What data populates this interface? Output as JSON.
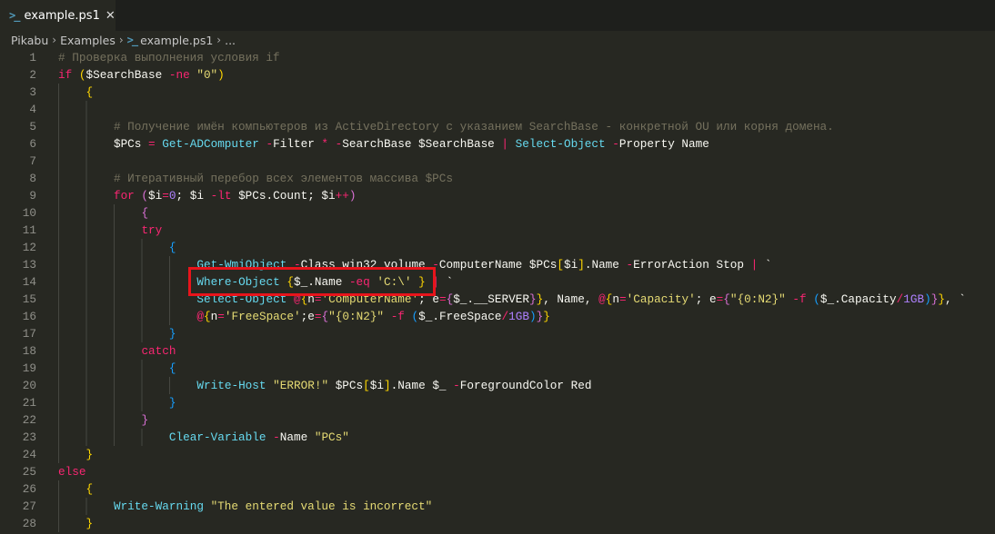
{
  "tab": {
    "title": "example.ps1",
    "icon": "powershell-icon"
  },
  "breadcrumb": [
    "Pikabu",
    "Examples",
    "example.ps1",
    "..."
  ],
  "lines": [
    {
      "i": 0,
      "t": [
        [
          "c",
          "# Проверка выполнения условия if"
        ]
      ]
    },
    {
      "i": 0,
      "t": [
        [
          "k",
          "if"
        ],
        [
          "t",
          " "
        ],
        [
          "b1",
          "("
        ],
        [
          "t",
          "$SearchBase "
        ],
        [
          "o",
          "-ne"
        ],
        [
          "t",
          " "
        ],
        [
          "s",
          "\"0\""
        ],
        [
          "b1",
          ")"
        ]
      ]
    },
    {
      "i": 4,
      "t": [
        [
          "b1",
          "{"
        ]
      ]
    },
    {
      "i": 8,
      "t": []
    },
    {
      "i": 8,
      "t": [
        [
          "c",
          "# Получение имён компьютеров из ActiveDirectory с указанием SearchBase - конкретной OU или корня домена."
        ]
      ]
    },
    {
      "i": 8,
      "t": [
        [
          "t",
          "$PCs "
        ],
        [
          "o",
          "="
        ],
        [
          "t",
          " "
        ],
        [
          "f",
          "Get-ADComputer"
        ],
        [
          "t",
          " "
        ],
        [
          "o",
          "-"
        ],
        [
          "t",
          "Filter "
        ],
        [
          "o",
          "*"
        ],
        [
          "t",
          " "
        ],
        [
          "o",
          "-"
        ],
        [
          "t",
          "SearchBase $SearchBase "
        ],
        [
          "o",
          "|"
        ],
        [
          "t",
          " "
        ],
        [
          "f",
          "Select-Object"
        ],
        [
          "t",
          " "
        ],
        [
          "o",
          "-"
        ],
        [
          "t",
          "Property Name"
        ]
      ]
    },
    {
      "i": 8,
      "t": []
    },
    {
      "i": 8,
      "t": [
        [
          "c",
          "# Итеративный перебор всех элементов массива $PCs"
        ]
      ]
    },
    {
      "i": 8,
      "t": [
        [
          "k",
          "for"
        ],
        [
          "t",
          " "
        ],
        [
          "b2",
          "("
        ],
        [
          "t",
          "$i"
        ],
        [
          "o",
          "="
        ],
        [
          "n",
          "0"
        ],
        [
          "t",
          "; $i "
        ],
        [
          "o",
          "-lt"
        ],
        [
          "t",
          " $PCs.Count; $i"
        ],
        [
          "o",
          "++"
        ],
        [
          "b2",
          ")"
        ]
      ]
    },
    {
      "i": 12,
      "t": [
        [
          "b2",
          "{"
        ]
      ]
    },
    {
      "i": 12,
      "t": [
        [
          "k",
          "try"
        ]
      ]
    },
    {
      "i": 16,
      "t": [
        [
          "b3",
          "{"
        ]
      ]
    },
    {
      "i": 20,
      "t": [
        [
          "f",
          "Get-WmiObject"
        ],
        [
          "t",
          " "
        ],
        [
          "o",
          "-"
        ],
        [
          "t",
          "Class win32_volume "
        ],
        [
          "o",
          "-"
        ],
        [
          "t",
          "ComputerName $PCs"
        ],
        [
          "b1",
          "["
        ],
        [
          "t",
          "$i"
        ],
        [
          "b1",
          "]"
        ],
        [
          "t",
          ".Name "
        ],
        [
          "o",
          "-"
        ],
        [
          "t",
          "ErrorAction Stop "
        ],
        [
          "o",
          "|"
        ],
        [
          "t",
          " `"
        ]
      ]
    },
    {
      "i": 20,
      "t": [
        [
          "f",
          "Where-Object"
        ],
        [
          "t",
          " "
        ],
        [
          "b1",
          "{"
        ],
        [
          "t",
          "$_.Name "
        ],
        [
          "o",
          "-eq"
        ],
        [
          "t",
          " "
        ],
        [
          "s",
          "'C:\\'"
        ],
        [
          "t",
          " "
        ],
        [
          "b1",
          "}"
        ],
        [
          "t",
          " "
        ],
        [
          "o",
          "|"
        ],
        [
          "t",
          " `"
        ]
      ]
    },
    {
      "i": 20,
      "t": [
        [
          "f",
          "Select-Object"
        ],
        [
          "t",
          " "
        ],
        [
          "o",
          "@"
        ],
        [
          "b1",
          "{"
        ],
        [
          "t",
          "n"
        ],
        [
          "o",
          "="
        ],
        [
          "s",
          "'ComputerName'"
        ],
        [
          "t",
          "; e"
        ],
        [
          "o",
          "="
        ],
        [
          "b2",
          "{"
        ],
        [
          "t",
          "$_.__SERVER"
        ],
        [
          "b2",
          "}"
        ],
        [
          "b1",
          "}"
        ],
        [
          "t",
          ", Name, "
        ],
        [
          "o",
          "@"
        ],
        [
          "b1",
          "{"
        ],
        [
          "t",
          "n"
        ],
        [
          "o",
          "="
        ],
        [
          "s",
          "'Capacity'"
        ],
        [
          "t",
          "; e"
        ],
        [
          "o",
          "="
        ],
        [
          "b2",
          "{"
        ],
        [
          "s",
          "\"{0:N2}\""
        ],
        [
          "t",
          " "
        ],
        [
          "o",
          "-f"
        ],
        [
          "t",
          " "
        ],
        [
          "b3",
          "("
        ],
        [
          "t",
          "$_.Capacity"
        ],
        [
          "o",
          "/"
        ],
        [
          "n",
          "1GB"
        ],
        [
          "b3",
          ")"
        ],
        [
          "b2",
          "}"
        ],
        [
          "b1",
          "}"
        ],
        [
          "t",
          ", `"
        ]
      ]
    },
    {
      "i": 20,
      "t": [
        [
          "o",
          "@"
        ],
        [
          "b1",
          "{"
        ],
        [
          "t",
          "n"
        ],
        [
          "o",
          "="
        ],
        [
          "s",
          "'FreeSpace'"
        ],
        [
          "t",
          ";e"
        ],
        [
          "o",
          "="
        ],
        [
          "b2",
          "{"
        ],
        [
          "s",
          "\"{0:N2}\""
        ],
        [
          "t",
          " "
        ],
        [
          "o",
          "-f"
        ],
        [
          "t",
          " "
        ],
        [
          "b3",
          "("
        ],
        [
          "t",
          "$_.FreeSpace"
        ],
        [
          "o",
          "/"
        ],
        [
          "n",
          "1GB"
        ],
        [
          "b3",
          ")"
        ],
        [
          "b2",
          "}"
        ],
        [
          "b1",
          "}"
        ]
      ]
    },
    {
      "i": 16,
      "t": [
        [
          "b3",
          "}"
        ]
      ]
    },
    {
      "i": 12,
      "t": [
        [
          "k",
          "catch"
        ]
      ]
    },
    {
      "i": 16,
      "t": [
        [
          "b3",
          "{"
        ]
      ]
    },
    {
      "i": 20,
      "t": [
        [
          "f",
          "Write-Host"
        ],
        [
          "t",
          " "
        ],
        [
          "s",
          "\"ERROR!\""
        ],
        [
          "t",
          " $PCs"
        ],
        [
          "b1",
          "["
        ],
        [
          "t",
          "$i"
        ],
        [
          "b1",
          "]"
        ],
        [
          "t",
          ".Name $_ "
        ],
        [
          "o",
          "-"
        ],
        [
          "t",
          "ForegroundColor Red"
        ]
      ]
    },
    {
      "i": 16,
      "t": [
        [
          "b3",
          "}"
        ]
      ]
    },
    {
      "i": 12,
      "t": [
        [
          "b2",
          "}"
        ]
      ]
    },
    {
      "i": 16,
      "t": [
        [
          "f",
          "Clear-Variable"
        ],
        [
          "t",
          " "
        ],
        [
          "o",
          "-"
        ],
        [
          "t",
          "Name "
        ],
        [
          "s",
          "\"PCs\""
        ]
      ]
    },
    {
      "i": 4,
      "t": [
        [
          "b1",
          "}"
        ]
      ]
    },
    {
      "i": 0,
      "t": [
        [
          "k",
          "else"
        ]
      ]
    },
    {
      "i": 4,
      "t": [
        [
          "b1",
          "{"
        ]
      ]
    },
    {
      "i": 8,
      "t": [
        [
          "f",
          "Write-Warning"
        ],
        [
          "t",
          " "
        ],
        [
          "s",
          "\"The entered value is incorrect\""
        ]
      ]
    },
    {
      "i": 4,
      "t": [
        [
          "b1",
          "}"
        ]
      ]
    }
  ]
}
